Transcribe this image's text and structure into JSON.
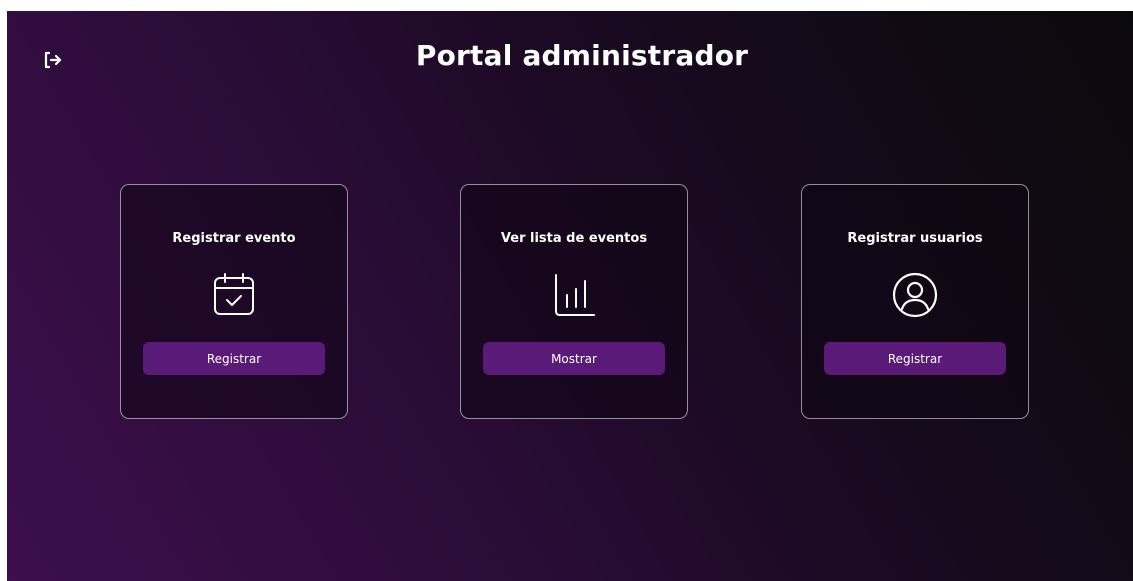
{
  "header": {
    "title": "Portal administrador",
    "logout_icon": "logout-arrow-icon"
  },
  "colors": {
    "accent": "#5a1a78",
    "background_start": "#3d0f4d",
    "background_end": "#0b0a0b",
    "text": "#ffffff"
  },
  "cards": [
    {
      "title": "Registrar evento",
      "icon": "calendar-check-icon",
      "button_label": "Registrar"
    },
    {
      "title": "Ver lista de eventos",
      "icon": "bar-chart-icon",
      "button_label": "Mostrar"
    },
    {
      "title": "Registrar usuarios",
      "icon": "user-circle-icon",
      "button_label": "Registrar"
    }
  ]
}
